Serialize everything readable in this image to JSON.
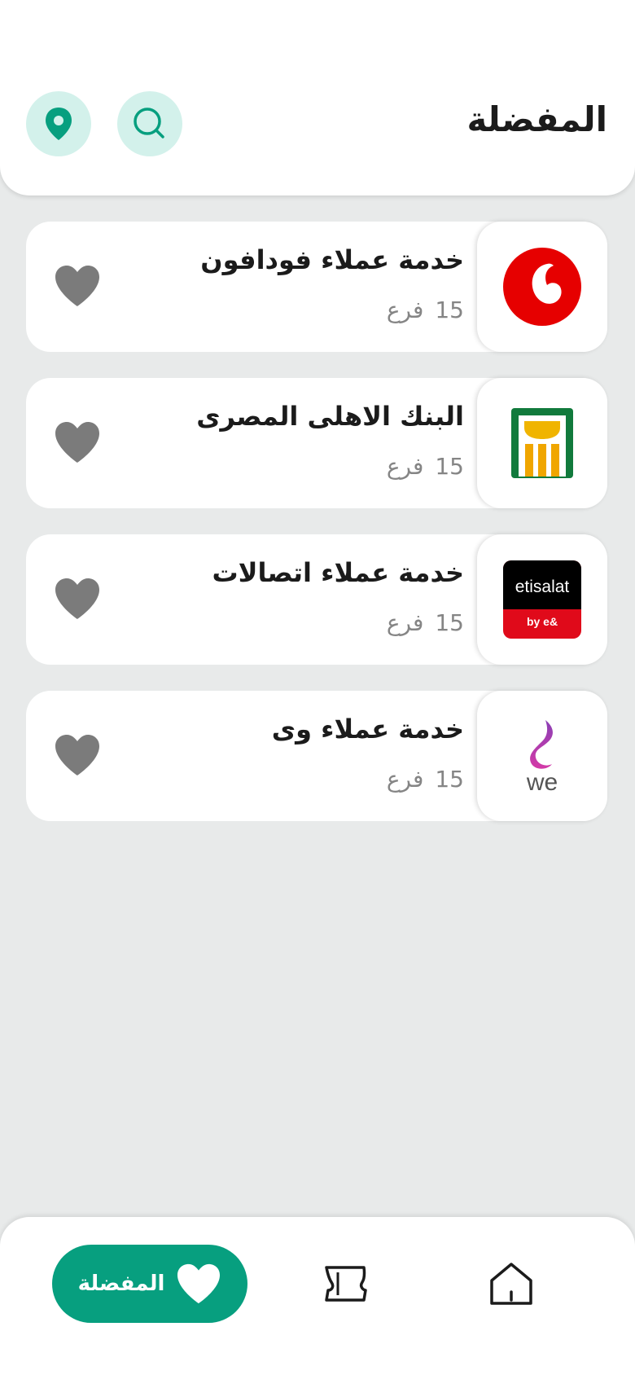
{
  "header": {
    "title": "المفضلة",
    "search_icon": "search-icon",
    "location_icon": "location-pin-icon",
    "accent_light": "#d3f1eb",
    "accent": "#079f7f"
  },
  "favorites": [
    {
      "name": "خدمة عملاء فودافون",
      "count": "15",
      "unit": "فرع",
      "logo": "vodafone-logo"
    },
    {
      "name": "البنك الاهلى المصرى",
      "count": "15",
      "unit": "فرع",
      "logo": "nbe-logo"
    },
    {
      "name": "خدمة عملاء  اتصالات",
      "count": "15",
      "unit": "فرع",
      "logo": "etisalat-logo",
      "logo_text": "etisalat",
      "logo_sub": "by e&"
    },
    {
      "name": "خدمة عملاء  وى",
      "count": "15",
      "unit": "فرع",
      "logo": "we-logo",
      "logo_text": "we"
    }
  ],
  "bottom_nav": {
    "active_label": "المفضلة",
    "items": [
      "home-icon",
      "tickets-icon",
      "favorites-icon"
    ]
  }
}
